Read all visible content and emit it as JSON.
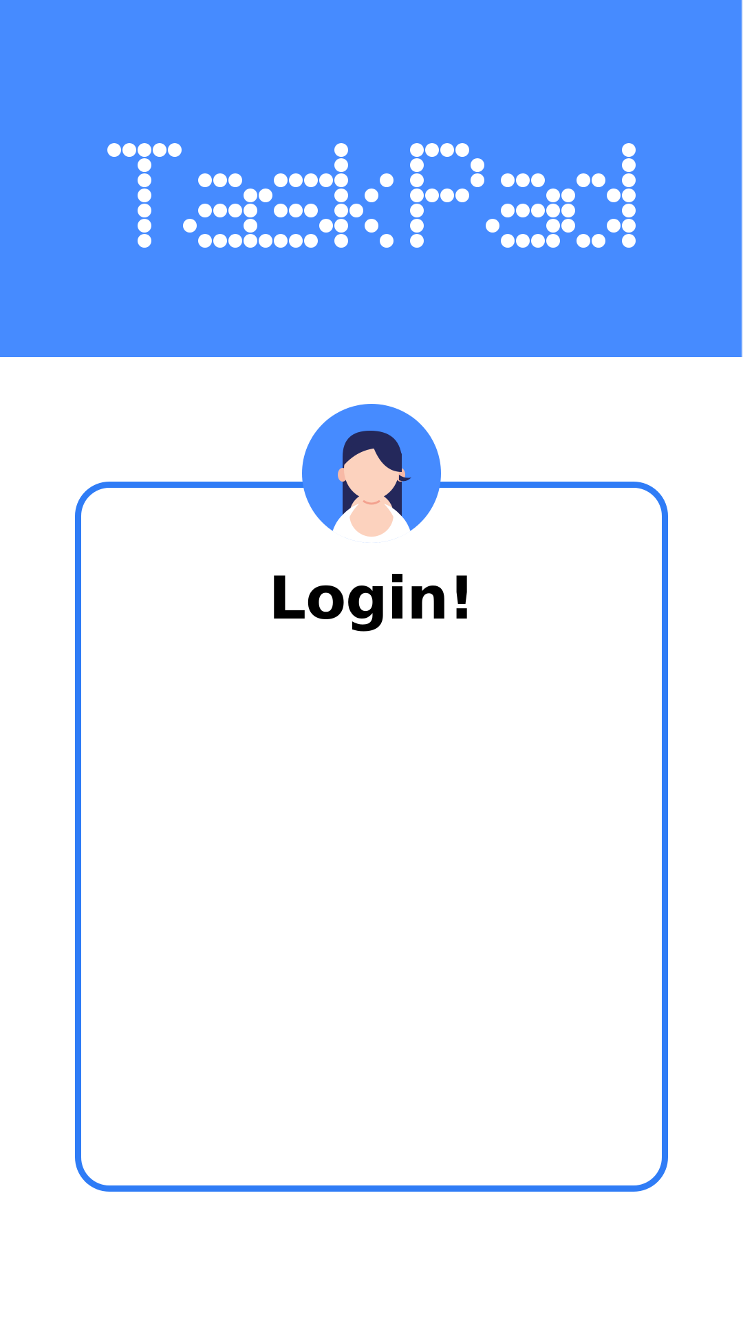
{
  "app": {
    "title": "TaskPad"
  },
  "login": {
    "heading": "Login!"
  },
  "avatar": {
    "icon": "user-avatar-icon"
  },
  "colors": {
    "header_background": "#468bff",
    "card_border": "#2f7cf6",
    "title_dots": "#ffffff",
    "heading_text": "#000000",
    "page_background": "#ffffff"
  }
}
